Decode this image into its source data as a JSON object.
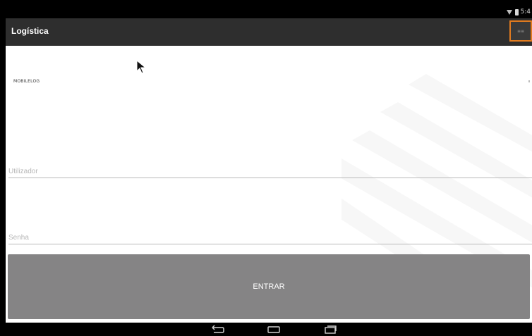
{
  "app_bar": {
    "title": "Logística",
    "overflow_label": "≡≡"
  },
  "status_bar": {
    "time": "5:4"
  },
  "login": {
    "brand": "MOBILELOG",
    "username_placeholder": "Utilizador",
    "password_placeholder": "Senha",
    "submit_label": "ENTRAR"
  },
  "navigation": {
    "back_icon": "back-icon",
    "home_icon": "home-icon",
    "recents_icon": "recents-icon"
  },
  "colors": {
    "status_bar": "#000000",
    "action_bar": "#2e2e2e",
    "highlight_border": "#e27b1f",
    "content_background": "#ffffff",
    "button_background": "#858485",
    "button_text": "#ffffff"
  }
}
